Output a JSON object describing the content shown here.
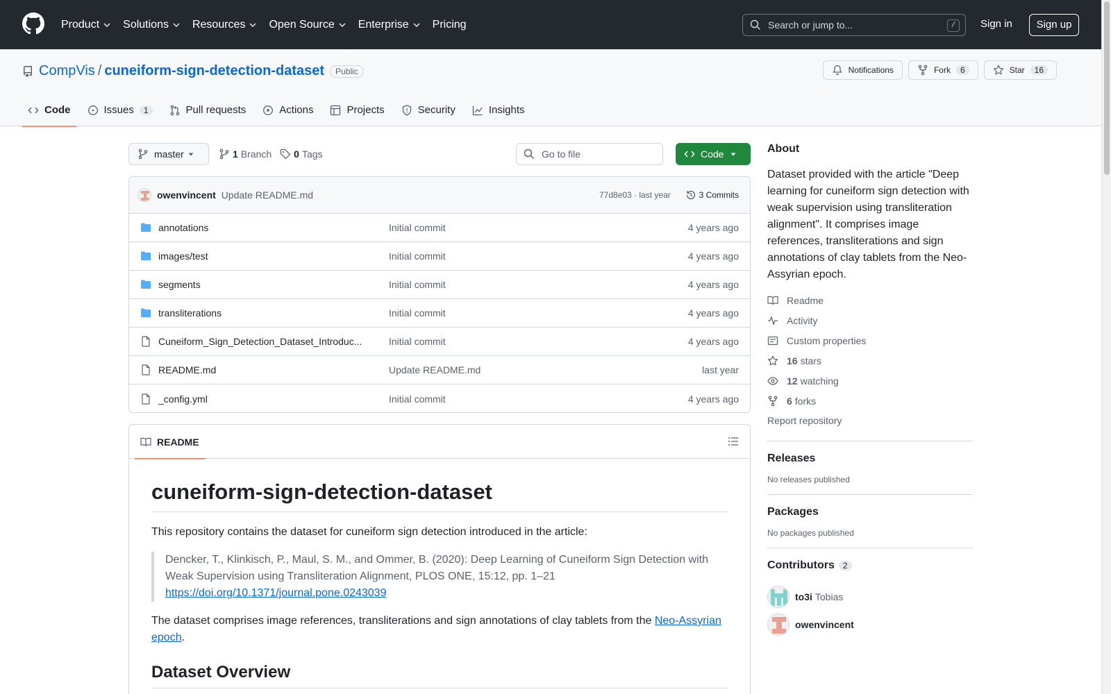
{
  "header": {
    "nav": [
      "Product",
      "Solutions",
      "Resources",
      "Open Source",
      "Enterprise",
      "Pricing"
    ],
    "search_placeholder": "Search or jump to...",
    "search_shortcut": "/",
    "sign_in": "Sign in",
    "sign_up": "Sign up"
  },
  "repo": {
    "owner": "CompVis",
    "separator": "/",
    "name": "cuneiform-sign-detection-dataset",
    "visibility": "Public",
    "notifications_label": "Notifications",
    "fork_label": "Fork",
    "fork_count": "6",
    "star_label": "Star",
    "star_count": "16"
  },
  "tabs": {
    "code": "Code",
    "issues": "Issues",
    "issues_count": "1",
    "pulls": "Pull requests",
    "actions": "Actions",
    "projects": "Projects",
    "security": "Security",
    "insights": "Insights"
  },
  "branch": {
    "name": "master",
    "branch_count": "1",
    "branch_label": "Branch",
    "tag_count": "0",
    "tag_label": "Tags",
    "goto_placeholder": "Go to file",
    "code_button": "Code"
  },
  "latest_commit": {
    "author": "owenvincent",
    "message": "Update README.md",
    "hash_time": "77d8e03 · last year",
    "commits_label": "3 Commits"
  },
  "files": [
    {
      "type": "folder",
      "name": "annotations",
      "message": "Initial commit",
      "age": "4 years ago"
    },
    {
      "type": "folder",
      "name": "images/test",
      "message": "Initial commit",
      "age": "4 years ago"
    },
    {
      "type": "folder",
      "name": "segments",
      "message": "Initial commit",
      "age": "4 years ago"
    },
    {
      "type": "folder",
      "name": "transliterations",
      "message": "Initial commit",
      "age": "4 years ago"
    },
    {
      "type": "file",
      "name": "Cuneiform_Sign_Detection_Dataset_Introduc...",
      "message": "Initial commit",
      "age": "4 years ago"
    },
    {
      "type": "file",
      "name": "README.md",
      "message": "Update README.md",
      "age": "last year"
    },
    {
      "type": "file",
      "name": "_config.yml",
      "message": "Initial commit",
      "age": "4 years ago"
    }
  ],
  "readme": {
    "tab_label": "README",
    "title": "cuneiform-sign-detection-dataset",
    "intro": "This repository contains the dataset for cuneiform sign detection introduced in the article:",
    "citation": "Dencker, T., Klinkisch, P., Maul, S. M., and Ommer, B. (2020): Deep Learning of Cuneiform Sign Detection with Weak Supervision using Transliteration Alignment, PLOS ONE, 15:12, pp. 1–21",
    "doi_link": "https://doi.org/10.1371/journal.pone.0243039",
    "comprises_prefix": "The dataset comprises image references, transliterations and sign annotations of clay tablets from the ",
    "comprises_link": "Neo-Assyrian epoch",
    "comprises_suffix": ".",
    "section_heading": "Dataset Overview"
  },
  "sidebar": {
    "about_heading": "About",
    "description": "Dataset provided with the article \"Deep learning for cuneiform sign detection with weak supervision using transliteration alignment\". It comprises image references, transliterations and sign annotations of clay tablets from the Neo-Assyrian epoch.",
    "readme": "Readme",
    "activity": "Activity",
    "custom_properties": "Custom properties",
    "stars_count": "16",
    "stars_label": "stars",
    "watching_count": "12",
    "watching_label": "watching",
    "forks_count": "6",
    "forks_label": "forks",
    "report": "Report repository",
    "releases_heading": "Releases",
    "releases_none": "No releases published",
    "packages_heading": "Packages",
    "packages_none": "No packages published",
    "contributors_heading": "Contributors",
    "contributors_count": "2",
    "contributors": [
      {
        "login": "to3i",
        "real_name": "Tobias"
      },
      {
        "login": "owenvincent",
        "real_name": ""
      }
    ]
  }
}
